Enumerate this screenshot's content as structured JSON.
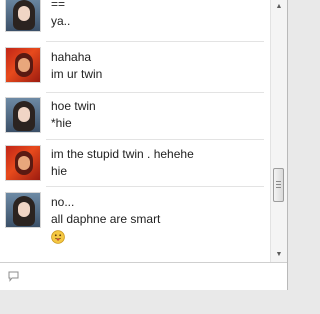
{
  "messages": [
    {
      "sender": "girl",
      "lines": [
        "==",
        "ya.."
      ],
      "emoticon": false
    },
    {
      "sender": "red",
      "lines": [
        "hahaha",
        "im ur twin"
      ],
      "emoticon": false
    },
    {
      "sender": "girl",
      "lines": [
        "hoe twin",
        "*hie"
      ],
      "emoticon": false
    },
    {
      "sender": "red",
      "lines": [
        "im the stupid twin . hehehe",
        "hie"
      ],
      "emoticon": false
    },
    {
      "sender": "girl",
      "lines": [
        "no...",
        "all daphne are smart"
      ],
      "emoticon": "tongue-out-emoticon"
    }
  ],
  "colors": {
    "text": "#222222",
    "emoticon_face": "#f5c842"
  },
  "scrollbar": {
    "up_arrow": "▲",
    "down_arrow": "▼"
  },
  "input": {
    "icon": "speech-bubble-icon",
    "value": ""
  }
}
